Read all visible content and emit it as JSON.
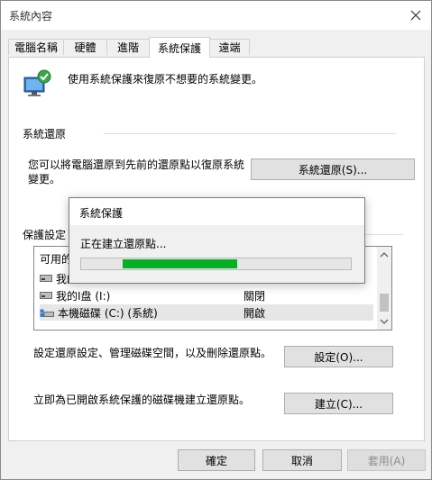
{
  "window": {
    "title": "系統內容",
    "close_icon": "close-icon"
  },
  "tabs": [
    {
      "label": "電腦名稱",
      "active": false
    },
    {
      "label": "硬體",
      "active": false
    },
    {
      "label": "進階",
      "active": false
    },
    {
      "label": "系統保護",
      "active": true
    },
    {
      "label": "遠端",
      "active": false
    }
  ],
  "intro": {
    "text": "使用系統保護來復原不想要的系統變更。",
    "icon": "system-protection-icon"
  },
  "restore": {
    "heading": "系統還原",
    "desc_line1": "您可以將電腦還原到先前的還原點以復原系統",
    "desc_line2": "變更。",
    "button": "系統還原(S)..."
  },
  "protection": {
    "heading": "保護設定",
    "list_header": "可用的",
    "drives": [
      {
        "name": "我的",
        "state": "",
        "icon": "drive-icon",
        "selected": false
      },
      {
        "name": "我的I盘 (I:)",
        "state": "關閉",
        "icon": "drive-icon",
        "selected": false
      },
      {
        "name": "本機磁碟 (C:) (系統)",
        "state": "開啟",
        "icon": "system-drive-icon",
        "selected": true
      }
    ]
  },
  "configure": {
    "text": "設定還原設定、管理磁碟空間，以及刪除還原點。",
    "button": "設定(O)..."
  },
  "create": {
    "text": "立即為已開啟系統保護的磁碟機建立還原點。",
    "button": "建立(C)..."
  },
  "footer": {
    "ok": "確定",
    "cancel": "取消",
    "apply": "套用(A)"
  },
  "dialog": {
    "title": "系統保護",
    "message": "正在建立還原點...",
    "progress_color": "#06b025"
  }
}
